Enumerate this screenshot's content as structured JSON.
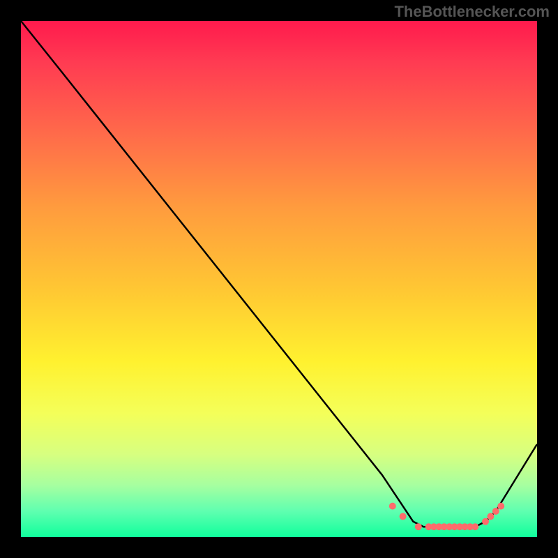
{
  "watermark": "TheBottlenecker.com",
  "chart_data": {
    "type": "line",
    "title": "",
    "xlabel": "",
    "ylabel": "",
    "xlim": [
      0,
      100
    ],
    "ylim": [
      0,
      100
    ],
    "series": [
      {
        "name": "curve",
        "x": [
          0,
          8,
          70,
          76,
          78,
          80,
          82,
          84,
          86,
          88,
          90,
          92,
          100
        ],
        "y": [
          100,
          90,
          12,
          3,
          2,
          2,
          2,
          2,
          2,
          2,
          3,
          5,
          18
        ]
      }
    ],
    "markers": {
      "name": "highlight-dots",
      "x": [
        72,
        74,
        77,
        79,
        80,
        81,
        82,
        83,
        84,
        85,
        86,
        87,
        88,
        90,
        91,
        92,
        93
      ],
      "y": [
        6,
        4,
        2,
        2,
        2,
        2,
        2,
        2,
        2,
        2,
        2,
        2,
        2,
        3,
        4,
        5,
        6
      ]
    },
    "background_gradient": [
      "#ff1a4d",
      "#ffc733",
      "#fff12f",
      "#10ff9c"
    ]
  }
}
